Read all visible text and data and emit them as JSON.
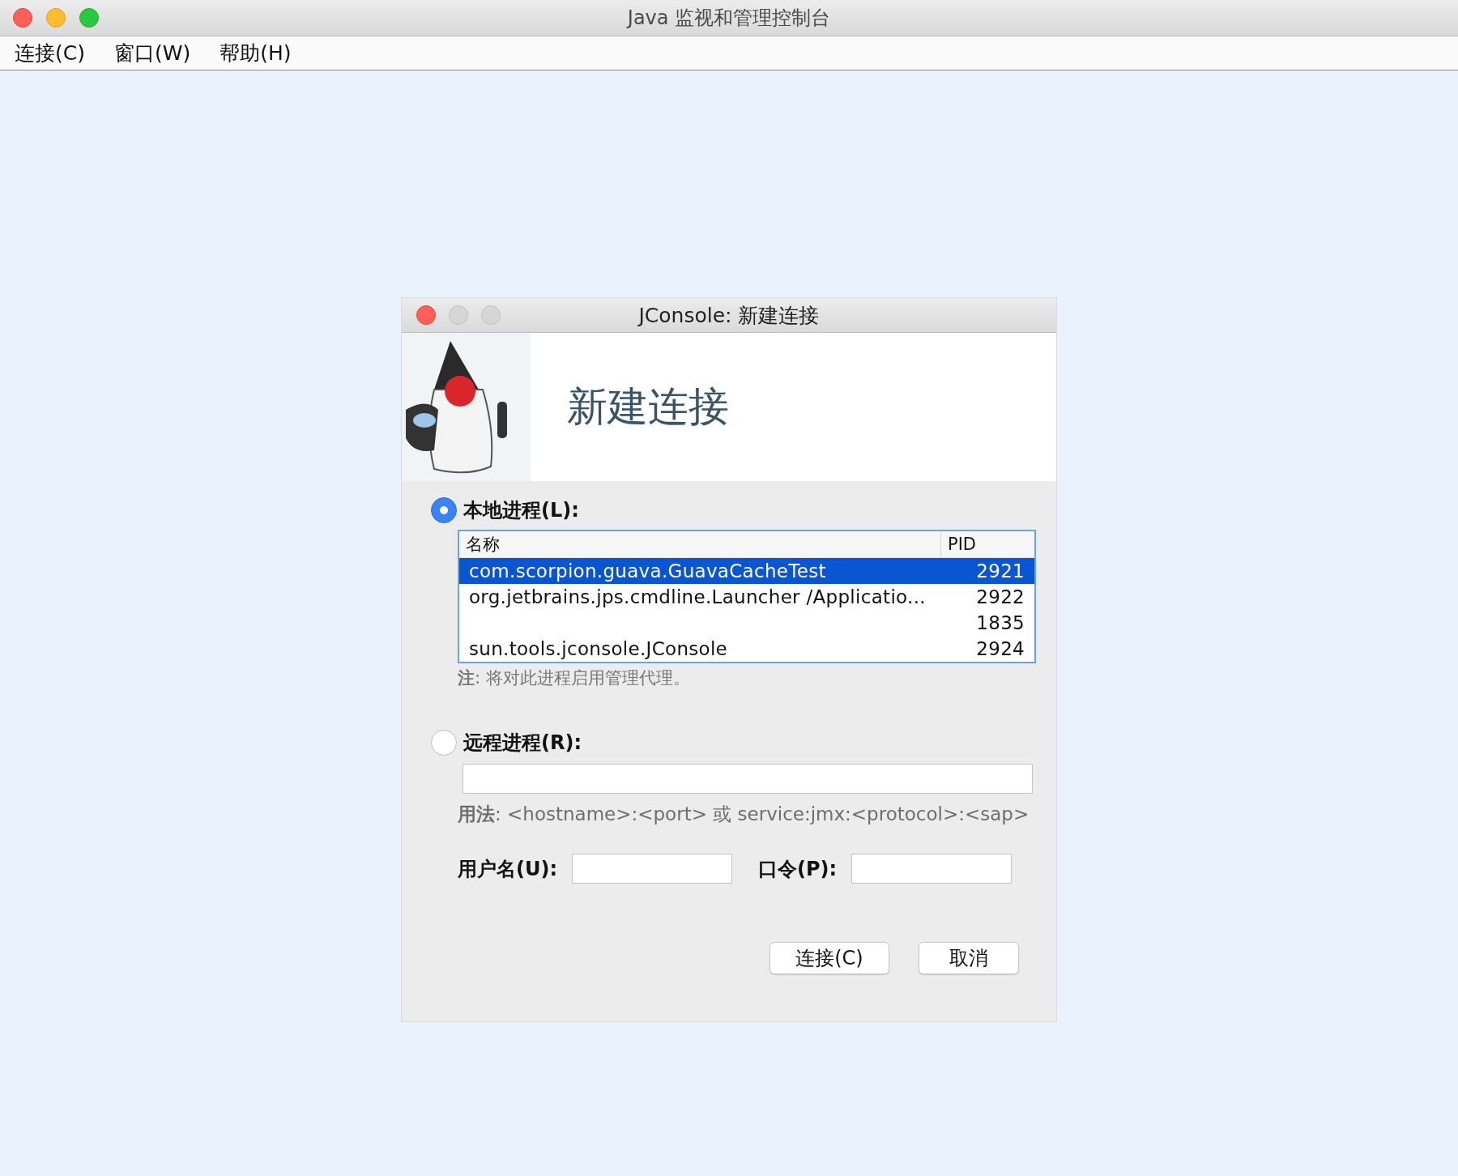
{
  "window": {
    "title": "Java 监视和管理控制台"
  },
  "menu": [
    "连接(C)",
    "窗口(W)",
    "帮助(H)"
  ],
  "dialog": {
    "title": "JConsole: 新建连接",
    "heading": "新建连接",
    "local": {
      "label": "本地进程(L):",
      "selected": true,
      "columns": [
        "名称",
        "PID"
      ],
      "rows": [
        {
          "name": "com.scorpion.guava.GuavaCacheTest",
          "pid": "2921",
          "selected": true
        },
        {
          "name": "org.jetbrains.jps.cmdline.Launcher /Applicatio...",
          "pid": "2922",
          "selected": false
        },
        {
          "pid": "1835",
          "selected": false
        },
        {
          "name": "sun.tools.jconsole.JConsole",
          "pid": "2924",
          "selected": false
        }
      ],
      "note": "**注**: 将对此进程启用管理代理。"
    },
    "remote": {
      "label": "远程进程(R):",
      "selected": false,
      "usage": "**用法**: <hostname>:<port> 或 service:jmx:<protocol>:<sap>"
    },
    "username_label": "用户名(U):",
    "password_label": "口令(P):",
    "buttons": [
      "连接(C)",
      "取消"
    ]
  }
}
